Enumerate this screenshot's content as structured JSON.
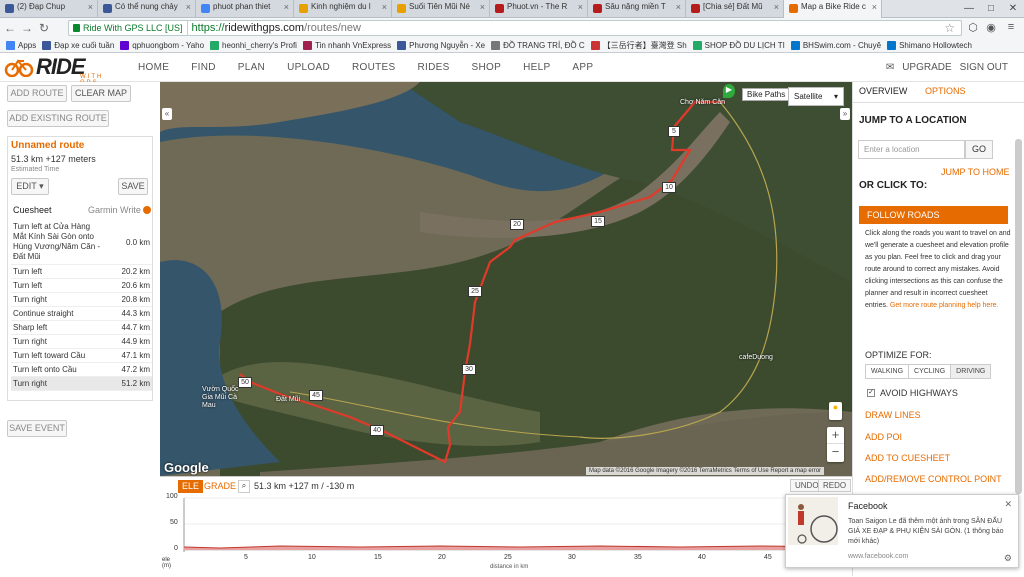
{
  "browser": {
    "tabs": [
      {
        "label": "(2) Đạp Chup",
        "color": "#3b5998"
      },
      {
        "label": "Có thể nung chảy",
        "color": "#3b5998"
      },
      {
        "label": "phuot phan thiet",
        "color": "#4285f4"
      },
      {
        "label": "Kinh nghiệm du l",
        "color": "#e6a100"
      },
      {
        "label": "Suối Tiên Mũi Né",
        "color": "#e6a100"
      },
      {
        "label": "Phuot.vn - The R",
        "color": "#b71c1c"
      },
      {
        "label": "Sâu nặng miền T",
        "color": "#b71c1c"
      },
      {
        "label": "[Chia sẻ] Đất Mũ",
        "color": "#b71c1c"
      },
      {
        "label": "Map a Bike Ride c",
        "color": "#e66b00"
      }
    ],
    "url": {
      "secure_label": "Ride With GPS LLC [US]",
      "scheme": "https://",
      "host": "ridewithgps.com",
      "path": "/routes/new"
    },
    "bookmarks": [
      {
        "label": "Apps",
        "color": "#4285f4"
      },
      {
        "label": "Đạp xe cuối tuần",
        "color": "#3b5998"
      },
      {
        "label": "qphuongbom - Yaho",
        "color": "#6001d2"
      },
      {
        "label": "heonhi_cherry's Profi",
        "color": "#2a6"
      },
      {
        "label": "Tin nhanh VnExpress",
        "color": "#9f224e"
      },
      {
        "label": "Phương Nguyễn - Xe",
        "color": "#3b5998"
      },
      {
        "label": "ĐỒ TRANG TRÍ, ĐỒ C",
        "color": "#777"
      },
      {
        "label": "【三岳行者】臺灣登 Sh",
        "color": "#c33"
      },
      {
        "label": "SHOP ĐỒ DU LỊCH TI",
        "color": "#2a6"
      },
      {
        "label": "BHSwim.com - Chuyê",
        "color": "#07c"
      },
      {
        "label": "Shimano Hollowtech",
        "color": "#07c"
      }
    ]
  },
  "site": {
    "logo_text": "RIDE",
    "logo_sub": "WITH GPS",
    "nav": [
      "HOME",
      "FIND",
      "PLAN",
      "UPLOAD",
      "ROUTES",
      "RIDES",
      "SHOP",
      "HELP",
      "APP"
    ],
    "upgrade": "UPGRADE",
    "signout": "SIGN OUT"
  },
  "left": {
    "add_route": "ADD ROUTE",
    "clear_map": "CLEAR MAP",
    "add_existing": "ADD EXISTING ROUTE",
    "route_name": "Unnamed route",
    "stats": "51.3 km +127 meters",
    "est_time": "Estimated Time",
    "edit": "EDIT",
    "save": "SAVE",
    "cuesheet": "Cuesheet",
    "garmin": "Garmin Write",
    "cues": [
      {
        "t": "Turn left at Cửa Hàng Mắt Kính Sài Gòn onto Hùng Vương/Năm Căn - Đất Mũi",
        "d": "0.0 km"
      },
      {
        "t": "Turn left",
        "d": "20.2 km"
      },
      {
        "t": "Turn left",
        "d": "20.6 km"
      },
      {
        "t": "Turn right",
        "d": "20.8 km"
      },
      {
        "t": "Continue straight",
        "d": "44.3 km"
      },
      {
        "t": "Sharp left",
        "d": "44.7 km"
      },
      {
        "t": "Turn right",
        "d": "44.9 km"
      },
      {
        "t": "Turn left toward Cầu",
        "d": "47.1 km"
      },
      {
        "t": "Turn left onto Cầu",
        "d": "47.2 km"
      },
      {
        "t": "Turn right",
        "d": "51.2 km"
      }
    ],
    "save_event": "SAVE EVENT"
  },
  "map": {
    "bike_paths": "Bike Paths",
    "map_type": "Satellite",
    "label_chonamcan": "Chợ Năm Căn",
    "label_cafeduong": "cafeDuong",
    "label_vuon": "Vườn Quốc Gia Mũi Cà Mau",
    "label_datmui": "Đất Mũi",
    "markers": [
      "5",
      "10",
      "15",
      "20",
      "25",
      "30",
      "40",
      "45",
      "50"
    ],
    "google": "Google",
    "attribution": "Map data ©2016 Google Imagery ©2016 TerraMetrics   Terms of Use   Report a map error"
  },
  "elevation": {
    "ele_tab": "ELE",
    "grade_tab": "GRADE",
    "stat": "51.3 km +127 m / -130 m",
    "undo": "UNDO",
    "redo": "REDO",
    "y_ticks": [
      "100",
      "50",
      "0"
    ],
    "y_axis_label": "ele (m)",
    "x_ticks": [
      "5",
      "10",
      "15",
      "20",
      "25",
      "30",
      "35",
      "40",
      "45"
    ],
    "x_label": "distance in km"
  },
  "right": {
    "tab_overview": "OVERVIEW",
    "tab_options": "OPTIONS",
    "jump_title": "JUMP TO A LOCATION",
    "location_placeholder": "Enter a location",
    "go": "GO",
    "jump_home": "JUMP TO HOME",
    "or_click": "OR CLICK TO:",
    "follow_roads": "FOLLOW ROADS",
    "help_text": "Click along the roads you want to travel on and we'll generate a cuesheet and elevation profile as you plan. Feel free to click and drag your route around to correct any mistakes. Avoid clicking intersections as this can confuse the planner and result in incorrect cuesheet entries.",
    "help_link": "Get more route planning help here.",
    "optimize_for": "OPTIMIZE FOR:",
    "modes": [
      "WALKING",
      "CYCLING",
      "DRIVING"
    ],
    "avoid_highways": "AVOID HIGHWAYS",
    "draw_lines": "DRAW LINES",
    "add_poi": "ADD POI",
    "add_to_cuesheet": "ADD TO CUESHEET",
    "add_remove_cp": "ADD/REMOVE CONTROL POINT"
  },
  "notification": {
    "title": "Facebook",
    "body": "Toan Saigon Le đã thêm một ảnh trong SÂN ĐẤU GIÁ XE ĐẠP & PHỤ KIỆN SÀI GÒN. (1 thông báo mới khác)",
    "source": "www.facebook.com"
  }
}
